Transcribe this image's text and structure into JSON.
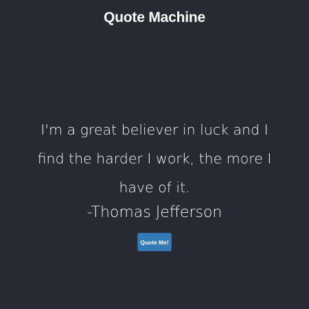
{
  "header": {
    "title": "Quote Machine"
  },
  "quote": {
    "text": "I'm a great believer in luck and I find the harder I work, the more I have of it.",
    "author": "-Thomas Jefferson"
  },
  "actions": {
    "quote_button_label": "Quote Me!"
  },
  "colors": {
    "background": "#282a33",
    "text": "#ffffff",
    "button": "#337ab7"
  }
}
